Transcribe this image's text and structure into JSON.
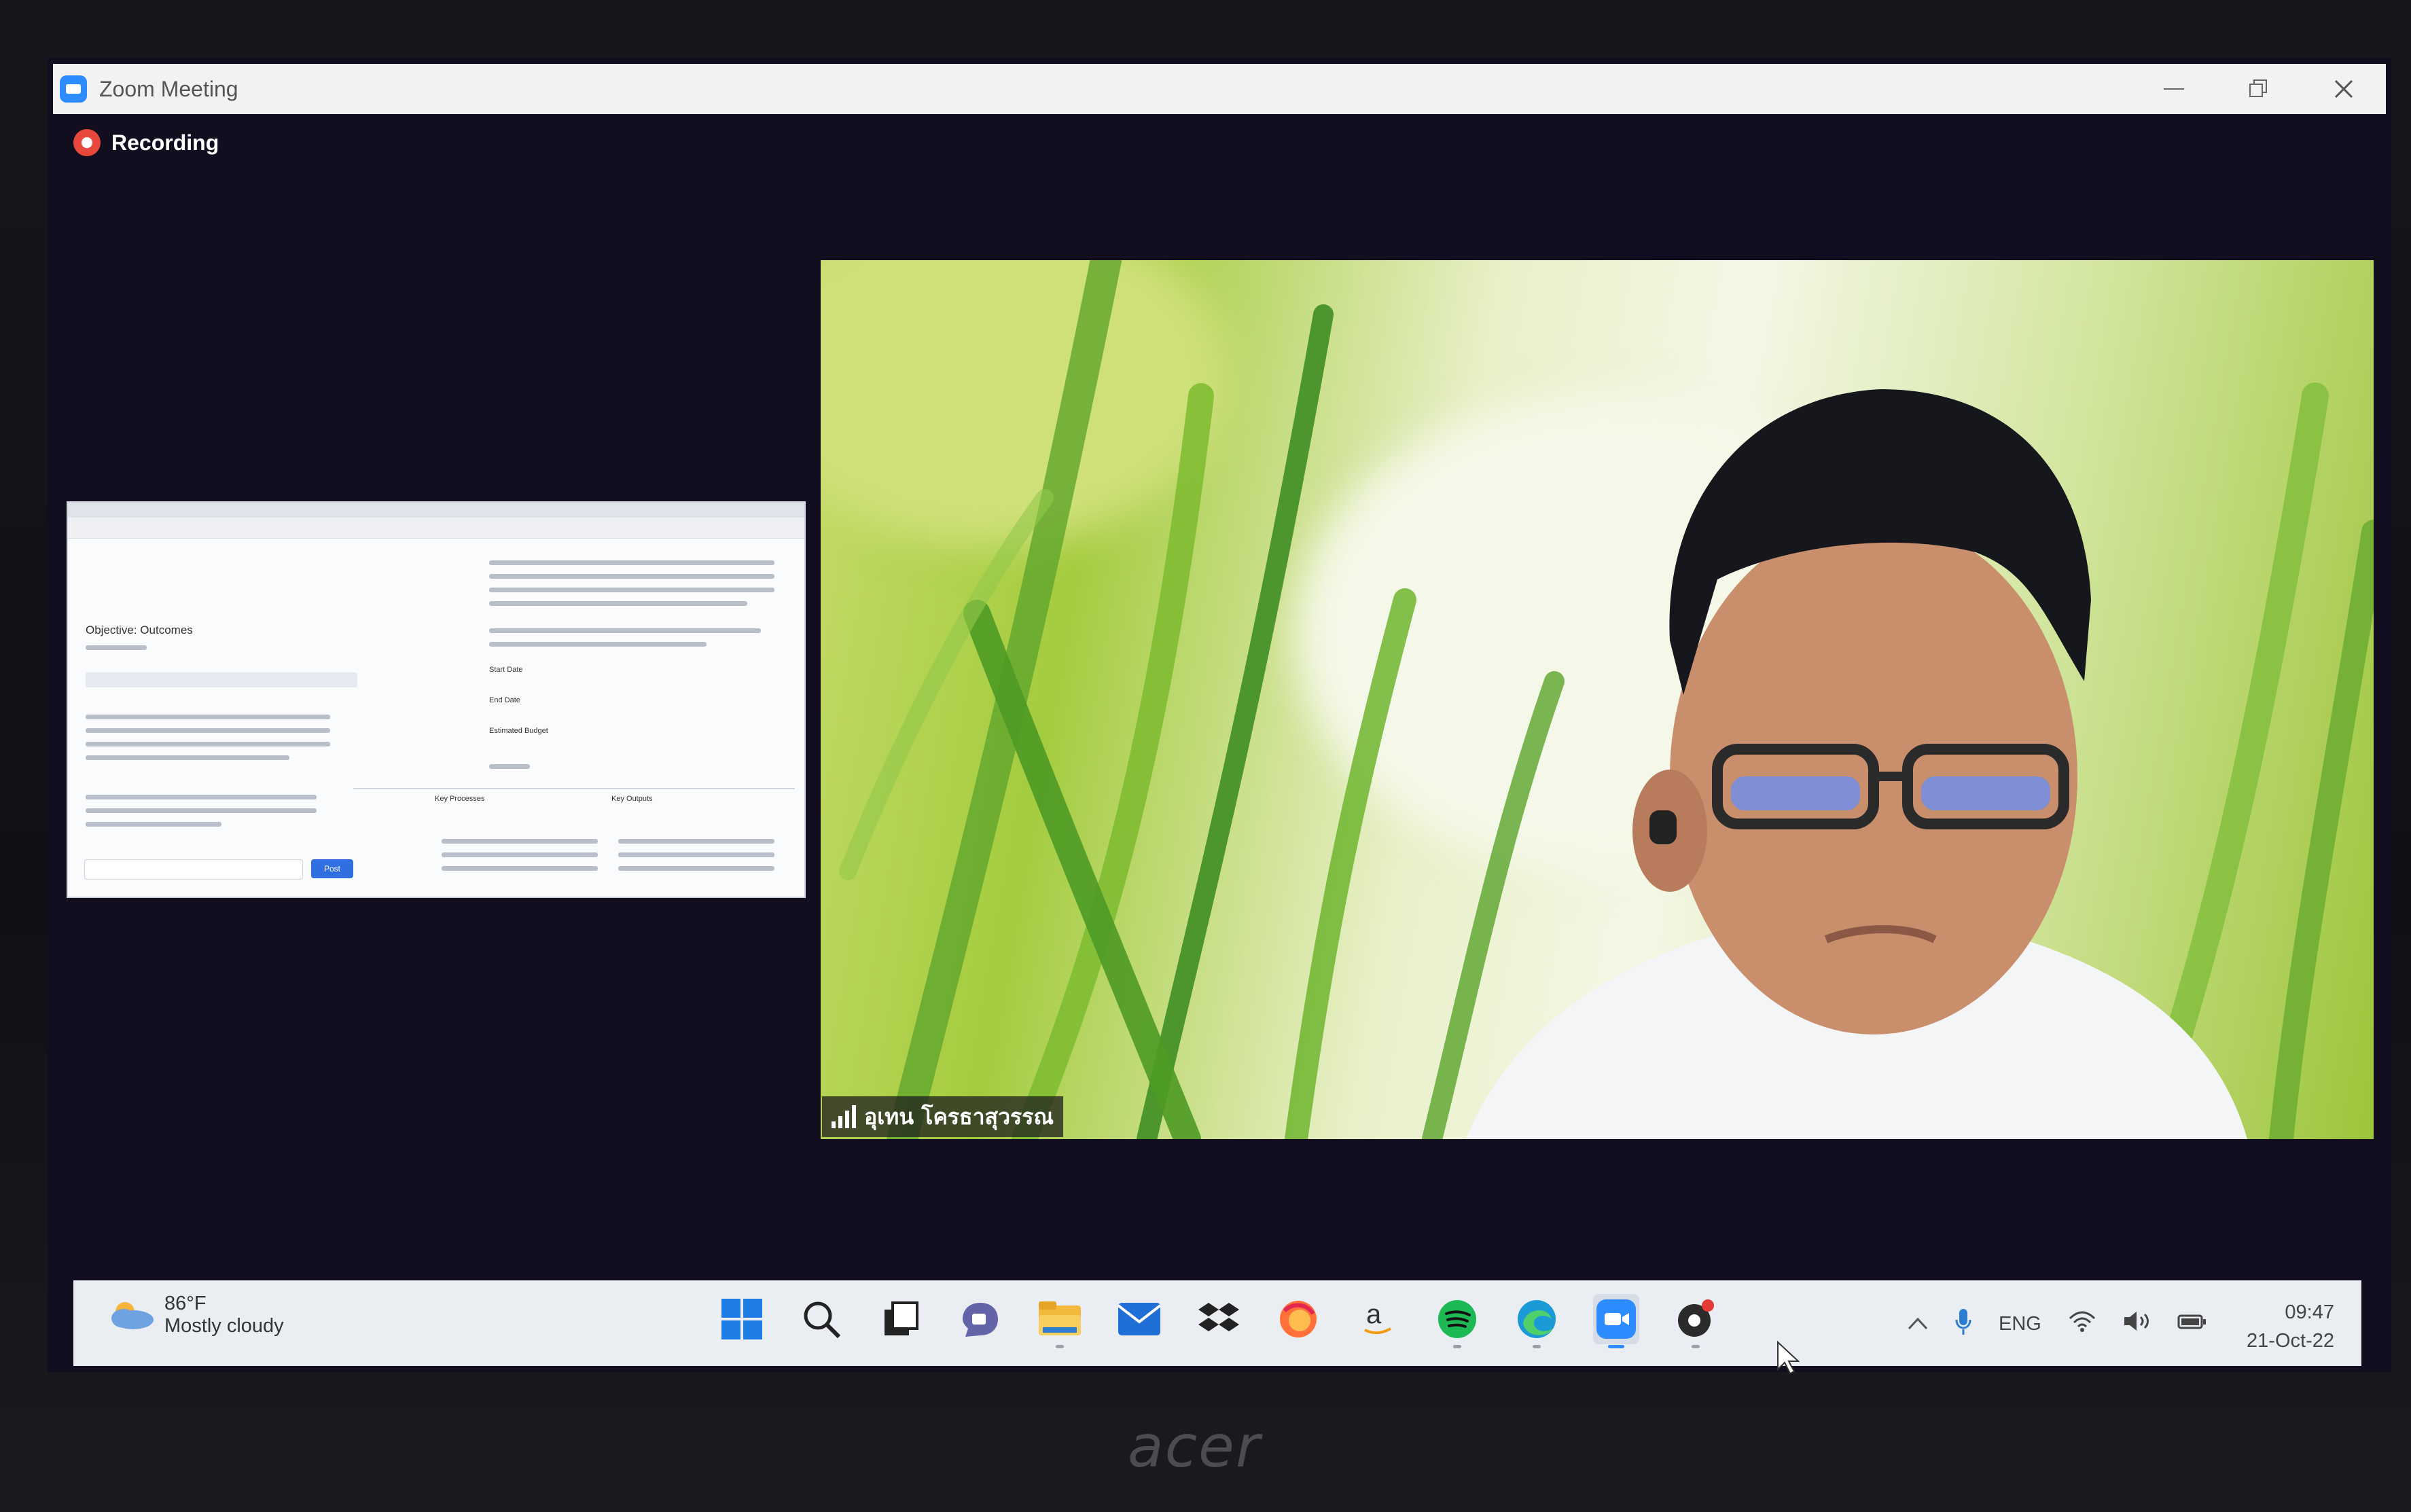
{
  "window": {
    "title": "Zoom Meeting",
    "controls": [
      "minimize",
      "restore",
      "close"
    ]
  },
  "recording": {
    "label": "Recording"
  },
  "shared_screen": {
    "heading": "Objective: Outcomes",
    "field_labels": [
      "Start Date",
      "End Date",
      "Estimated Budget",
      "Key Processes",
      "Key Outputs"
    ],
    "submit_label": "Post"
  },
  "participant": {
    "name": "อุเทน โครธาสุวรรณ"
  },
  "taskbar": {
    "weather": {
      "temp": "86°F",
      "desc": "Mostly cloudy"
    },
    "apps": [
      "start-icon",
      "search-icon",
      "task-view-icon",
      "teams-chat-icon",
      "file-explorer-icon",
      "mail-icon",
      "dropbox-icon",
      "firefox-icon",
      "amazon-icon",
      "spotify-icon",
      "edge-icon",
      "zoom-icon",
      "obs-icon"
    ],
    "tray": {
      "language": "ENG"
    },
    "clock": {
      "time": "09:47",
      "date": "21-Oct-22"
    }
  },
  "hardware": {
    "brand": "acer"
  },
  "colors": {
    "zoom_blue": "#2d8cff",
    "recording_red": "#e8483b",
    "taskbar_bg": "#eaedf2"
  }
}
